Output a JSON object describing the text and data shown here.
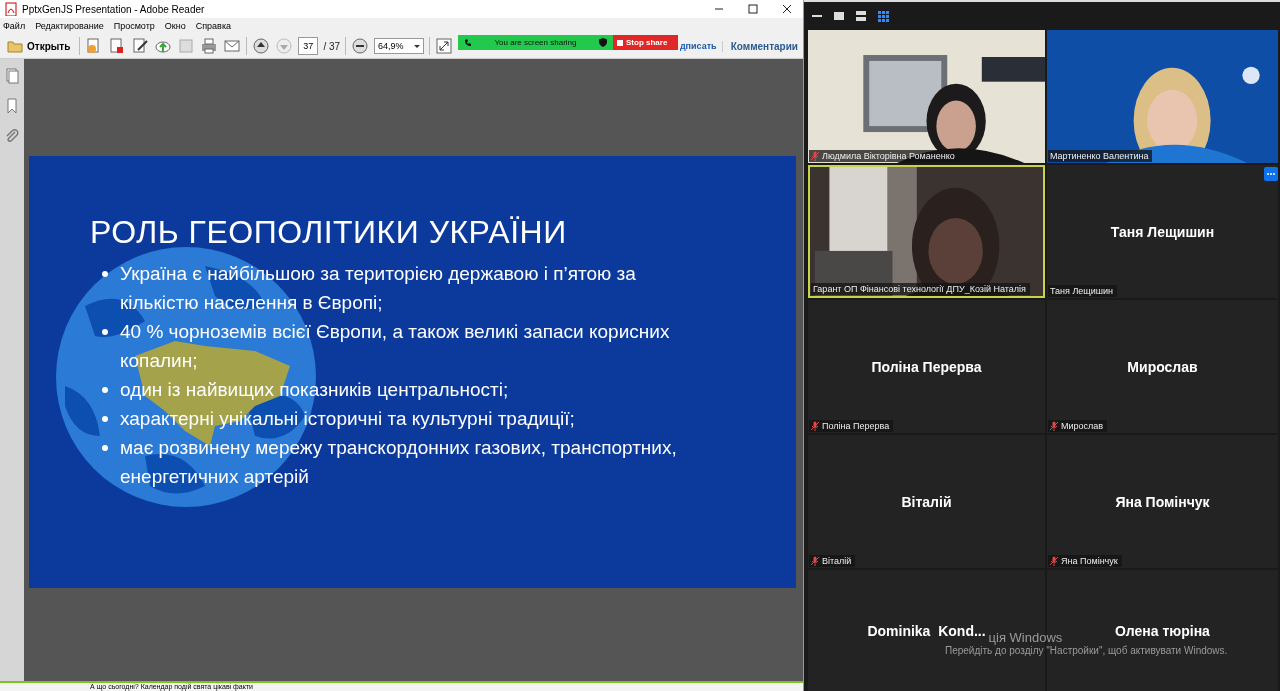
{
  "window": {
    "title": "PptxGenJS Presentation - Adobe Reader"
  },
  "menu": [
    "Файл",
    "Редактирование",
    "Просмотр",
    "Окно",
    "Справка"
  ],
  "toolbar": {
    "open_label": "Открыть",
    "page": "37",
    "page_total": "/ 37",
    "zoom": "64,9%",
    "sign_label": "дписать",
    "comments_label": "Комментарии"
  },
  "slide": {
    "title": "РОЛЬ ГЕОПОЛІТИКИ УКРАЇНИ",
    "bullets": [
      "Україна є найбільшою за територією державою і п’ятою за кількістю населення в Європі;",
      "40 % чорноземів всієї Європи, а також великі запаси корисних копалин;",
      "один із найвищих показників центральності;",
      "характерні унікальні історичні та культурні традиції;",
      "має розвинену мережу транскордонних газових, транспортних, енергетичних артерій"
    ]
  },
  "share_bar": {
    "status": "You are screen sharing",
    "stop_label": "Stop share"
  },
  "taskbar": {
    "item": "А що сьогодні? Календар подій свята цікаві факти"
  },
  "meeting": {
    "views": [
      {
        "kind": "minimize",
        "selected": false
      },
      {
        "kind": "speaker",
        "selected": false
      },
      {
        "kind": "strip",
        "selected": false
      },
      {
        "kind": "gallery",
        "selected": true
      }
    ],
    "participants": [
      {
        "kind": "video",
        "label": "Людмила Вікторівна Романенко",
        "muted": true,
        "speaking": false,
        "show_more": false
      },
      {
        "kind": "video",
        "label": "Мартиненко Валентина",
        "muted": false,
        "speaking": false,
        "show_more": false
      },
      {
        "kind": "video",
        "label": "Гарант ОП Фінансові технології ДПУ_Козій Наталія",
        "muted": false,
        "speaking": true,
        "show_more": false
      },
      {
        "kind": "name",
        "name": "Таня Лещишин",
        "label": "Таня Лещишин",
        "muted": false,
        "speaking": false,
        "show_more": true
      },
      {
        "kind": "name",
        "name": "Поліна Перерва",
        "label": "Поліна Перерва",
        "muted": true,
        "speaking": false,
        "show_more": false
      },
      {
        "kind": "name",
        "name": "Мирослав",
        "label": "Мирослав",
        "muted": true,
        "speaking": false,
        "show_more": false
      },
      {
        "kind": "name",
        "name": "Віталій",
        "label": "Віталій",
        "muted": true,
        "speaking": false,
        "show_more": false
      },
      {
        "kind": "name",
        "name": "Яна Помінчук",
        "label": "Яна Помінчук",
        "muted": true,
        "speaking": false,
        "show_more": false
      },
      {
        "kind": "name",
        "name": "Dominika  Kond...",
        "speaking": false
      },
      {
        "kind": "name",
        "name": "Олена тюріна",
        "speaking": false
      }
    ]
  },
  "os_watermark": {
    "title": "ція Windows",
    "hint": "Перейдіть до розділу \"Настройки\", щоб активувати Windows."
  }
}
